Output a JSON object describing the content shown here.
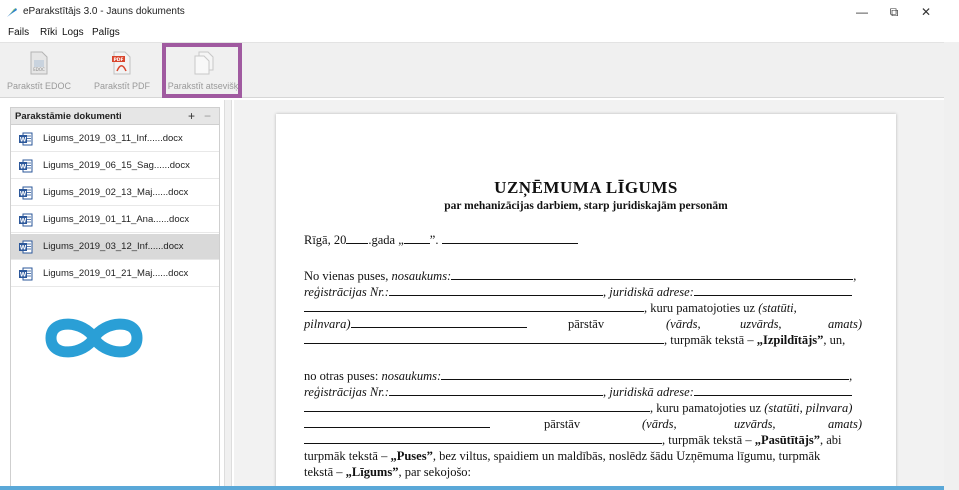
{
  "window": {
    "title": "eParakstītājs 3.0 - Jauns dokuments",
    "minimize": "—",
    "maximize": "⧉",
    "close": "✕"
  },
  "menu": [
    "Fails",
    "Rīki",
    "Logs",
    "Palīgs"
  ],
  "toolbar": {
    "sign_edoc": "Parakstīt EDOC",
    "sign_pdf": "Parakstīt PDF",
    "sign_separately": "Parakstīt atsevišķi"
  },
  "sidebar": {
    "title": "Parakstāmie dokumenti",
    "add": "+",
    "remove": "−",
    "items": [
      {
        "name": "Ligums_2019_03_11_Inf......docx",
        "selected": false
      },
      {
        "name": "Ligums_2019_06_15_Sag......docx",
        "selected": false
      },
      {
        "name": "Ligums_2019_02_13_Maj......docx",
        "selected": false
      },
      {
        "name": "Ligums_2019_01_11_Ana......docx",
        "selected": false
      },
      {
        "name": "Ligums_2019_03_12_Inf......docx",
        "selected": true
      },
      {
        "name": "Ligums_2019_01_21_Maj......docx",
        "selected": false
      }
    ]
  },
  "document": {
    "title": "UZŅĒMUMA LĪGUMS",
    "subtitle": "par mehanizācijas darbiem, starp juridiskajām personām",
    "date_line": {
      "a": "Rīgā, 20",
      "b": ".gada „",
      "c": "”."
    },
    "p1": {
      "l1": "No vienas puses, ",
      "l1i": "nosaukums:",
      "l2i": "reģistrācijas Nr.:",
      "l2b": ", ",
      "l2c": "juridiskā adrese:",
      "l3a": ",   kuru   pamatojoties   uz   ",
      "l3b": "(statūti,",
      "l4a": "pilnvara)",
      "l4b": "pārstāv",
      "l4c": "(vārds,",
      "l4d": "uzvārds,",
      "l4e": "amats)",
      "l5a": ", turpmāk tekstā – ",
      "l5b": "„Izpildītājs”",
      "l5c": ", un,"
    },
    "p2": {
      "l1": "no otras puses: ",
      "l1i": "nosaukums:",
      "l2i": "reģistrācijas Nr.:",
      "l2c": "juridiskā adrese:",
      "l3a": ", kuru pamatojoties uz ",
      "l3b": "(statūti, pilnvara)",
      "l4b": "pārstāv",
      "l4c": "(vārds,",
      "l4d": "uzvārds,",
      "l4e": "amats)",
      "l5a": ", turpmāk tekstā – ",
      "l5b": "„Pasūtītājs”",
      "l5c": ", abi",
      "l6a": "turpmāk tekstā – ",
      "l6b": "„Puses”",
      "l6c": ", bez viltus, spaidiem un maldībās, noslēdz šādu Uzņēmuma līgumu, turpmāk",
      "l7a": "tekstā – ",
      "l7b": "„Līgums”",
      "l7c": ", par sekojošo:"
    }
  },
  "colors": {
    "highlight": "#a05aa0",
    "infinity": "#2a9fd6",
    "word_blue": "#2b579a",
    "pdf_red": "#d9442b"
  }
}
